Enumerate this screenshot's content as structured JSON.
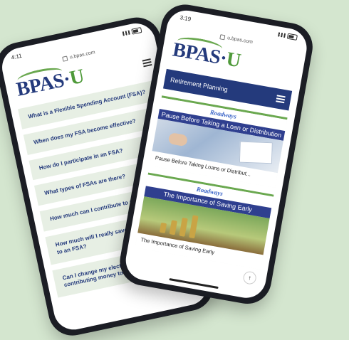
{
  "left_phone": {
    "time": "4:11",
    "url": "u.bpas.com",
    "logo": {
      "main": "BPAS·",
      "accent": "U"
    },
    "faq": [
      {
        "question": "What is a Flexible Spending Account (FSA)?"
      },
      {
        "question": "When does my FSA become effective?"
      },
      {
        "question": "How do I participate in an FSA?"
      },
      {
        "question": "What types of FSAs are there?"
      },
      {
        "question": "How much can I contribute to my FSA?"
      },
      {
        "question": "How much will I really save by contributing to an FSA?"
      },
      {
        "question": "Can I change my election or stop contributing money to my FSA at any"
      }
    ]
  },
  "right_phone": {
    "time": "3:19",
    "url": "u.bpas.com",
    "logo": {
      "main": "BPAS·",
      "accent": "U"
    },
    "section_title": "Retirement Planning",
    "cards": [
      {
        "brand": "Roadways",
        "title": "Pause Before Taking a Loan or Distribution",
        "caption": "Pause Before Taking Loans or Distribut..."
      },
      {
        "brand": "Roadways",
        "title": "The Importance of Saving Early",
        "caption": "The Importance of Saving Early"
      }
    ],
    "scroll_top_glyph": "↑"
  },
  "colors": {
    "background": "#d4e6cf",
    "navy": "#243a7c",
    "green": "#6aa84f",
    "faq_bg": "#e7efe4"
  }
}
